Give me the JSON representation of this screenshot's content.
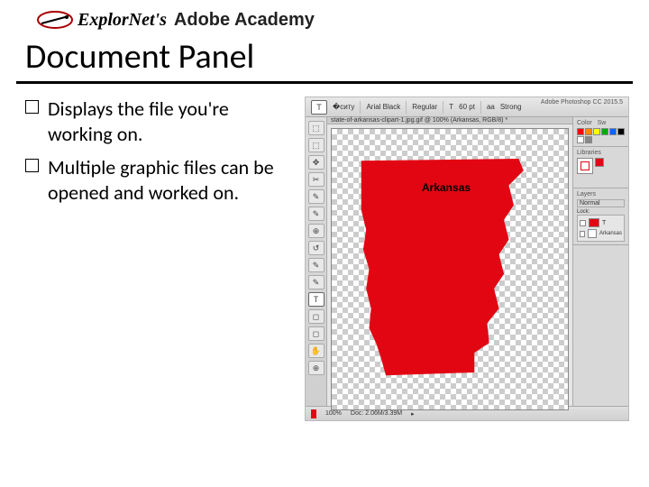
{
  "brand": {
    "name1": "ExplorNet's",
    "name2": "Adobe Academy"
  },
  "slide": {
    "title": "Document Panel",
    "bullets": [
      "Displays the file you're working on.",
      "Multiple graphic files can be opened and worked on."
    ]
  },
  "photoshop": {
    "app_title": "Adobe Photoshop CC 2015.5",
    "options_bar": {
      "tool_glyph": "T",
      "font_name": "Arial Black",
      "font_style": "Regular",
      "font_size_glyph": "T",
      "font_size": "60 pt",
      "aa_label": "aa",
      "aa_value": "Strong"
    },
    "document_tab": "state-of-arkansas-clipart-1.jpg.gif @ 100% (Arkansas, RGB/8) *",
    "canvas_label": "Arkansas",
    "status": {
      "zoom": "100%",
      "doc_info": "Doc: 2.06M/3.39M"
    },
    "panels": {
      "color_title": "Color",
      "swatches_title": "Sw",
      "libraries_title": "Libraries",
      "layers_title": "Layers",
      "layer_mode": "Normal",
      "lock_label": "Lock:",
      "layers": [
        "Arkansas",
        "T"
      ]
    },
    "tool_glyphs": [
      "⬚",
      "⬚",
      "✥",
      "✂",
      "✎",
      "✎",
      "⊕",
      "↺",
      "✎",
      "✎",
      "T",
      "◻",
      "◻",
      "✋",
      "⊕"
    ],
    "swatch_colors": [
      "#ff0000",
      "#ff8800",
      "#ffff00",
      "#00aa00",
      "#0066ff",
      "#000000",
      "#ffffff",
      "#888888"
    ]
  }
}
